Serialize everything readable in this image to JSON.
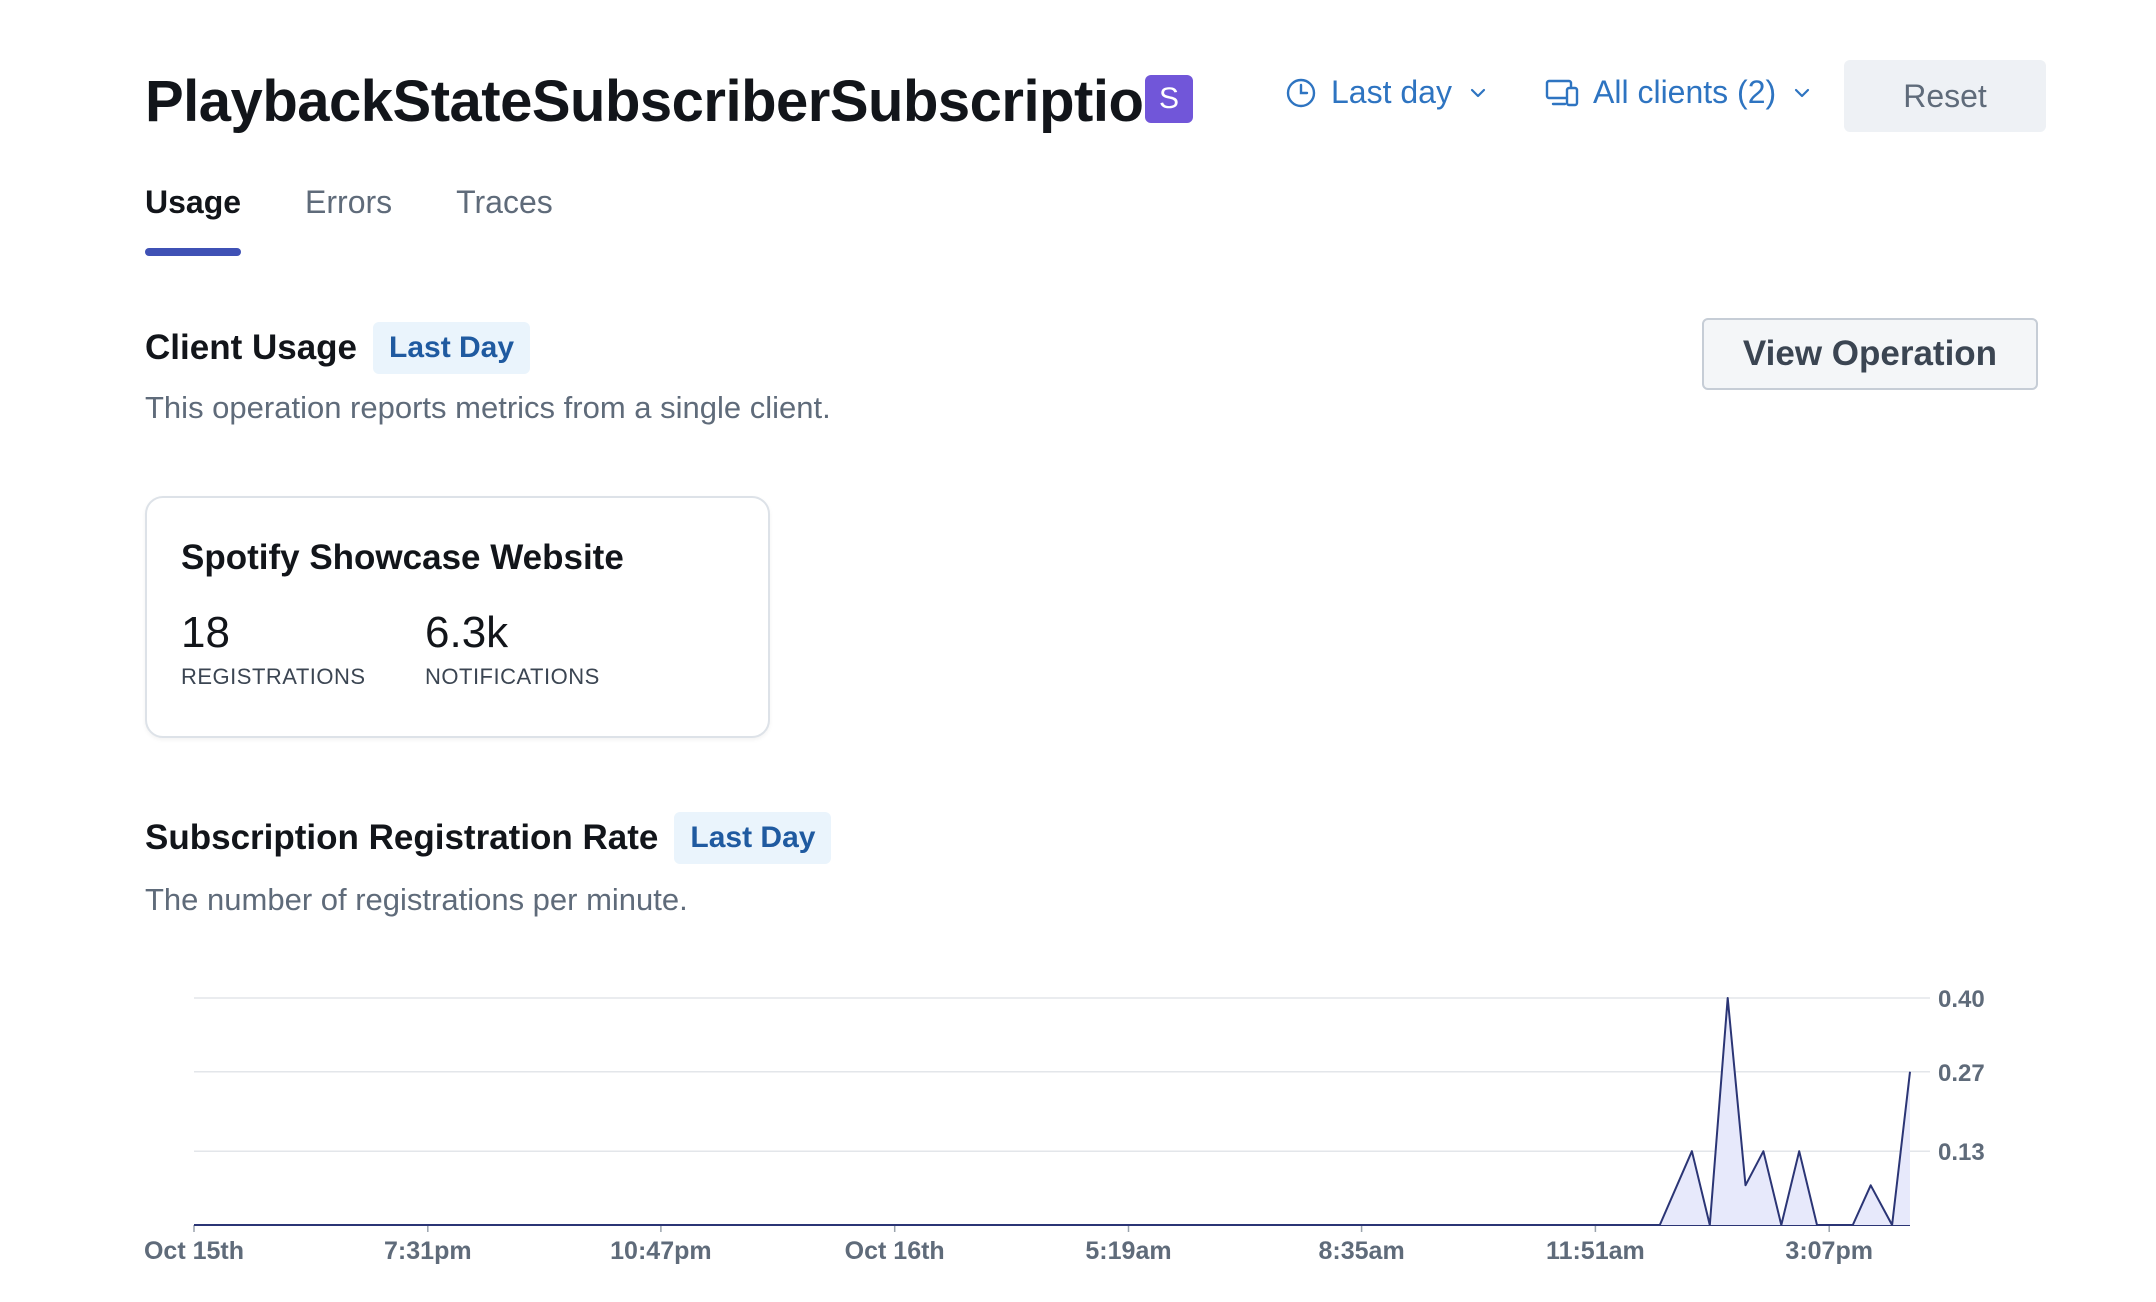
{
  "header": {
    "title": "PlaybackStateSubscriberSubscription",
    "type_badge": "S",
    "time_filter": {
      "label": "Last day",
      "icon": "clock-icon"
    },
    "client_filter": {
      "label": "All clients (2)",
      "icon": "devices-icon"
    },
    "reset_label": "Reset"
  },
  "tabs": [
    {
      "label": "Usage",
      "active": true
    },
    {
      "label": "Errors",
      "active": false
    },
    {
      "label": "Traces",
      "active": false
    }
  ],
  "client_usage": {
    "title": "Client Usage",
    "period": "Last Day",
    "description": "This operation reports metrics from a single client.",
    "view_operation_label": "View Operation",
    "clients": [
      {
        "name": "Spotify Showcase Website",
        "registrations_value": "18",
        "registrations_label": "REGISTRATIONS",
        "notifications_value": "6.3k",
        "notifications_label": "NOTIFICATIONS"
      }
    ]
  },
  "registration_rate": {
    "title": "Subscription Registration Rate",
    "period": "Last Day",
    "description": "The number of registrations per minute."
  },
  "colors": {
    "accent": "#3f51b5",
    "link": "#2e74c1",
    "badge": "#7156d9",
    "series_line": "#2b3575",
    "series_fill": "#e7e9fb"
  },
  "chart_data": {
    "type": "area",
    "title": "",
    "xlabel": "",
    "ylabel": "",
    "ylim": [
      0,
      0.4
    ],
    "y_ticks": [
      "0.13",
      "0.27",
      "0.40"
    ],
    "y_tick_values": [
      0.13,
      0.27,
      0.4
    ],
    "x_tick_labels": [
      "Oct 15th",
      "7:31pm",
      "10:47pm",
      "Oct 16th",
      "5:19am",
      "8:35am",
      "11:51am",
      "3:07pm"
    ],
    "x_tick_hours": [
      0,
      3.27,
      6.53,
      9.8,
      13.07,
      16.33,
      19.6,
      22.87
    ],
    "x_range_hours": [
      0,
      24
    ],
    "grid": true,
    "y_axis_side": "right",
    "series": [
      {
        "hours": [
          0,
          20.5,
          20.95,
          21.2,
          21.45,
          21.7,
          21.95,
          22.2,
          22.45,
          22.7,
          22.95,
          23.2,
          23.45,
          23.75,
          24
        ],
        "values": [
          0,
          0,
          0.13,
          0,
          0.4,
          0.07,
          0.13,
          0,
          0.13,
          0,
          0,
          0,
          0.07,
          0,
          0.27
        ]
      }
    ]
  }
}
